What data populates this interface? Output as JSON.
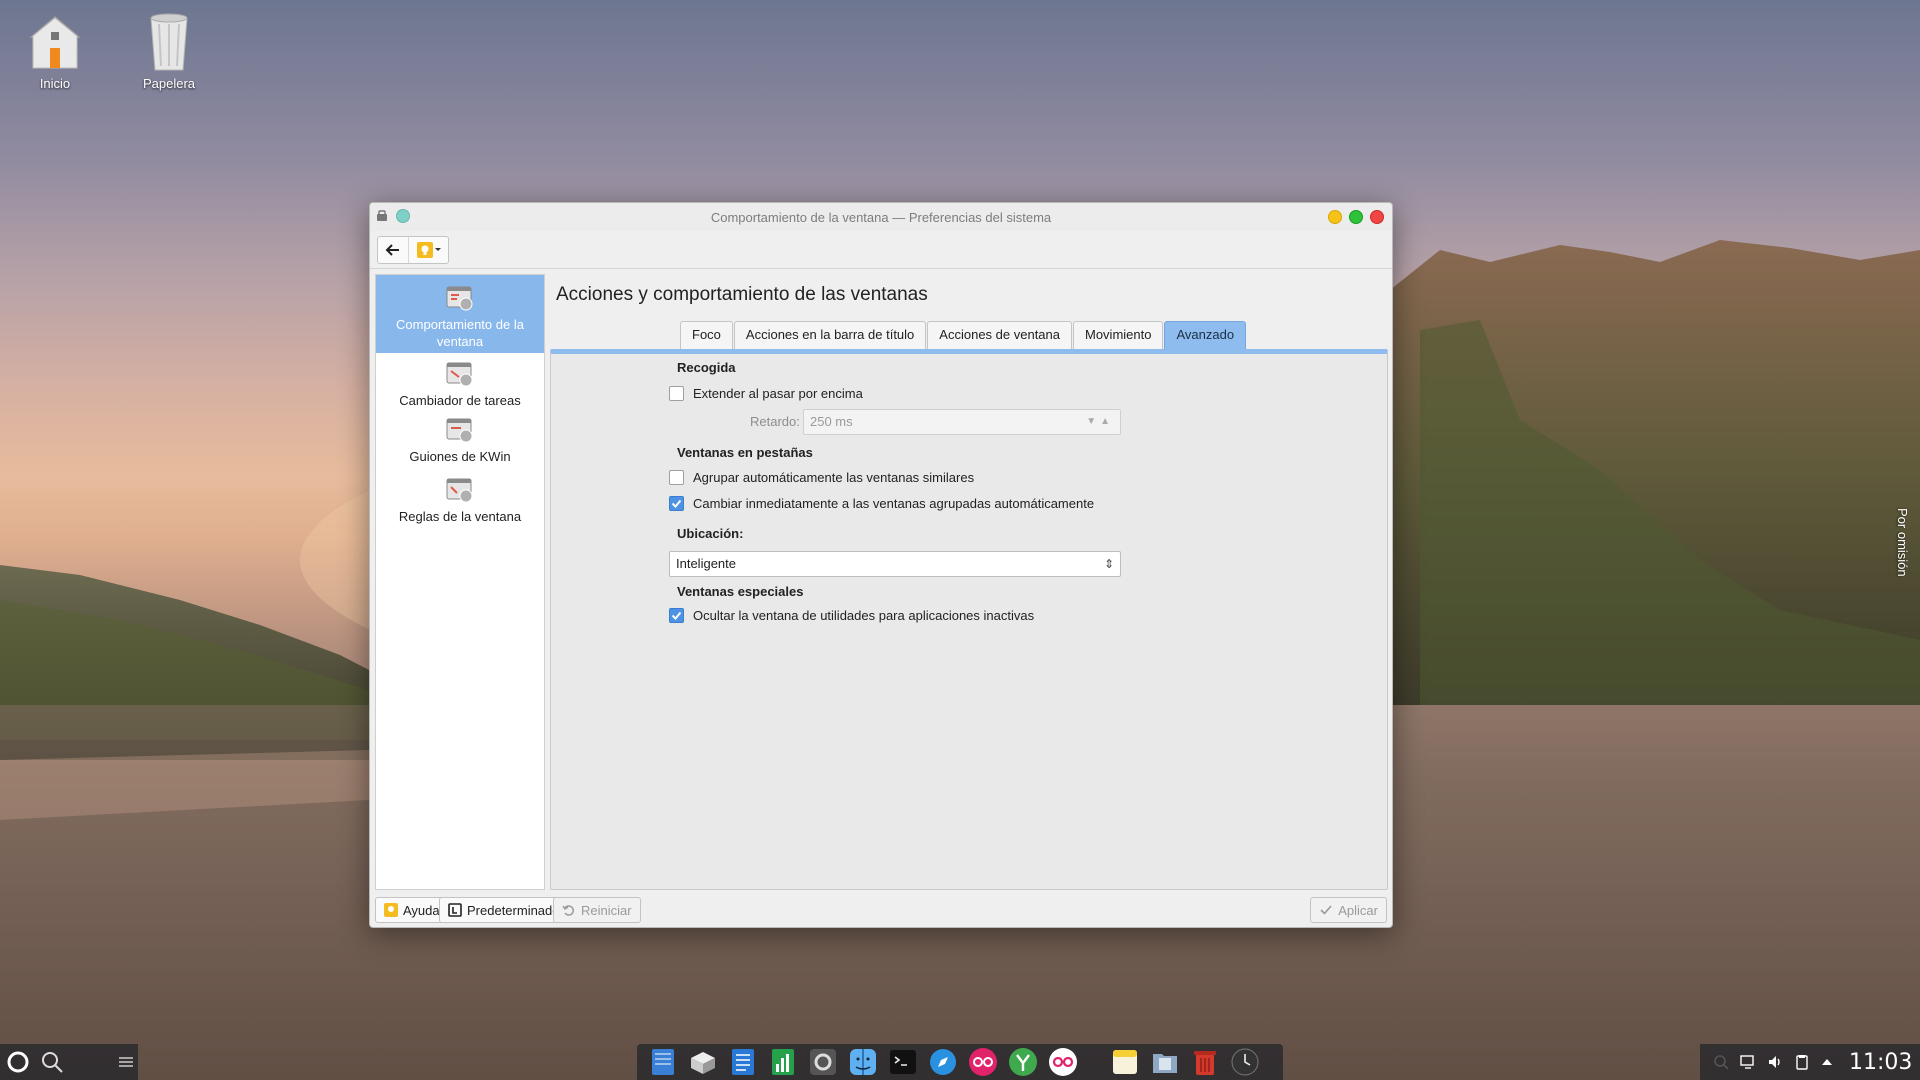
{
  "desktop": {
    "icons": [
      {
        "label": "Inicio",
        "icon": "home-folder-icon"
      },
      {
        "label": "Papelera",
        "icon": "trash-icon"
      }
    ],
    "edge_label": "Por omisión"
  },
  "window": {
    "title": "Comportamiento de la ventana — Preferencias del sistema",
    "sidebar": [
      {
        "label": "Comportamiento de la ventana",
        "active": true
      },
      {
        "label": "Cambiador de tareas"
      },
      {
        "label": "Guiones de KWin"
      },
      {
        "label": "Reglas de la ventana"
      }
    ],
    "page_title": "Acciones y comportamiento de las ventanas",
    "tabs": [
      "Foco",
      "Acciones en la barra de título",
      "Acciones de ventana",
      "Movimiento",
      "Avanzado"
    ],
    "active_tab": "Avanzado",
    "advanced": {
      "recogida": {
        "heading": "Recogida",
        "extend_hover": {
          "label": "Extender al pasar por encima",
          "checked": false
        },
        "delay_label": "Retardo:",
        "delay_value": "250 ms"
      },
      "tabbing": {
        "heading": "Ventanas en pestañas",
        "group_auto": {
          "label": "Agrupar automáticamente las ventanas similares",
          "checked": false
        },
        "switch_grouped": {
          "label": "Cambiar inmediatamente a las ventanas agrupadas automáticamente",
          "checked": true
        }
      },
      "placement": {
        "heading": "Ubicación:",
        "value": "Inteligente"
      },
      "special": {
        "heading": "Ventanas especiales",
        "hide_utility": {
          "label": "Ocultar la ventana de utilidades para aplicaciones inactivas",
          "checked": true
        }
      }
    },
    "footer": {
      "help": "Ayuda",
      "defaults": "Predeterminados",
      "reset": "Reiniciar",
      "apply": "Aplicar"
    }
  },
  "tray": {
    "clock": "11:03"
  },
  "colors": {
    "accent": "#8fbcef",
    "checkbox": "#4d93e5"
  }
}
